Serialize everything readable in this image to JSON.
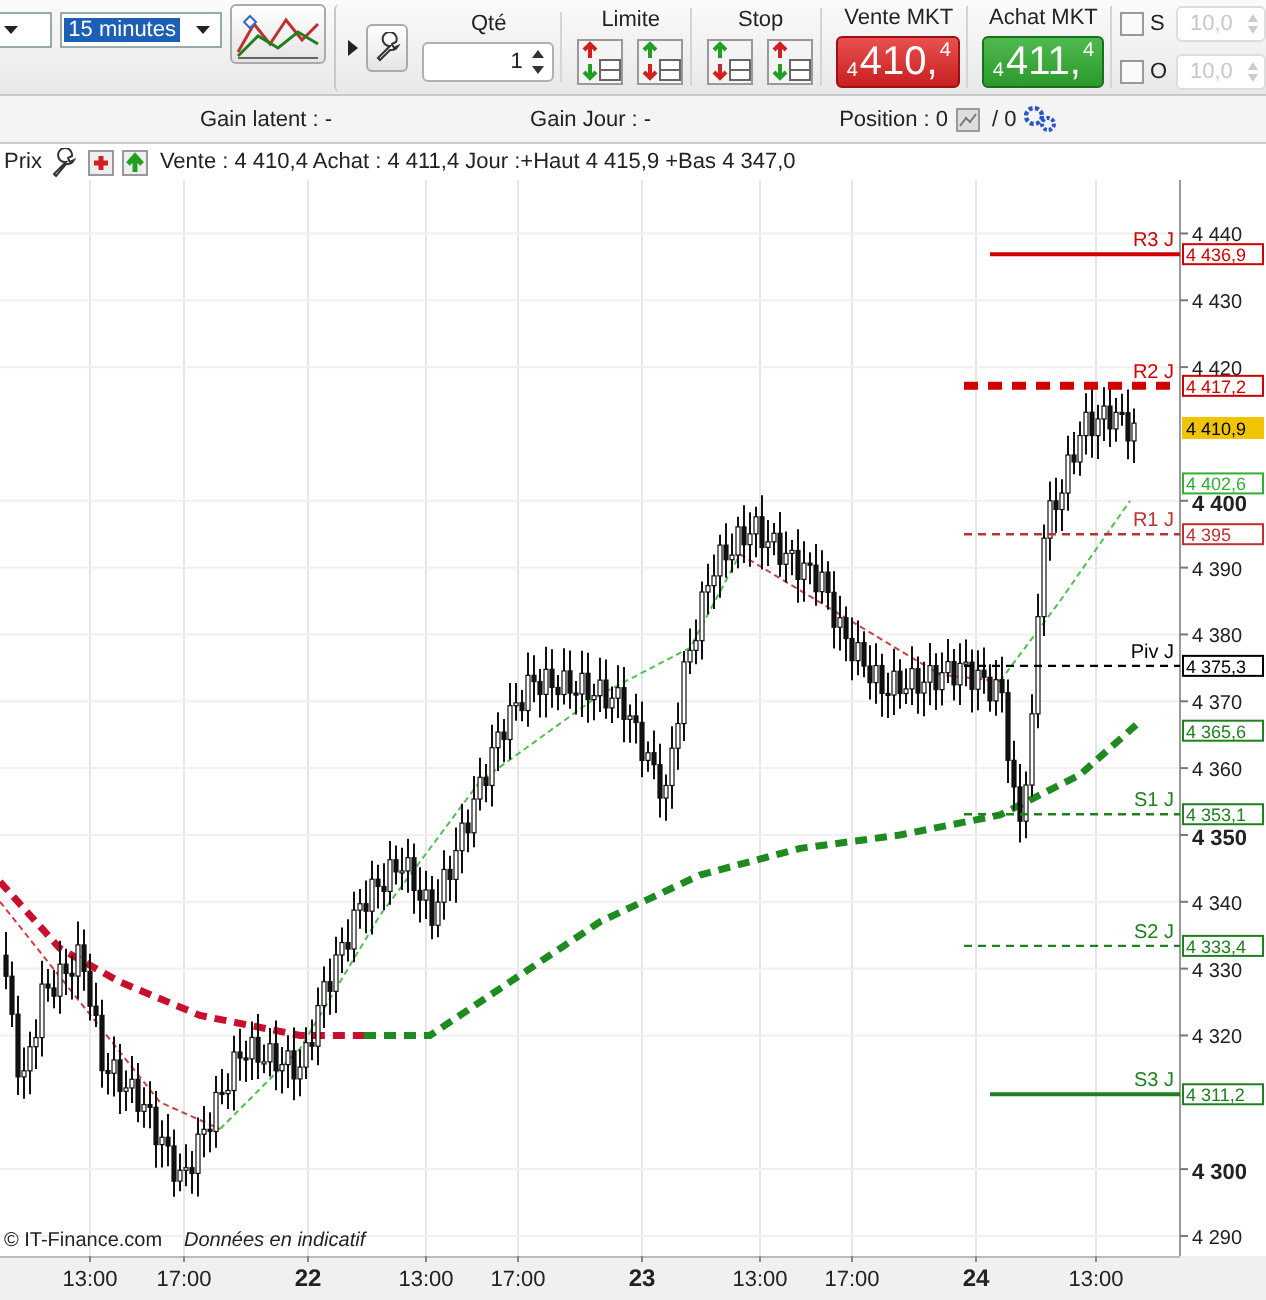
{
  "toolbar": {
    "interval": {
      "value": "15 minutes",
      "selected": true
    },
    "quantity": {
      "label": "Qté",
      "value": "1"
    },
    "limit": {
      "label": "Limite"
    },
    "stop": {
      "label": "Stop"
    },
    "orders": [
      {
        "kind": "sell",
        "label": "Vente MKT",
        "prefix": "4",
        "big": "410,",
        "suffix": "4"
      },
      {
        "kind": "buy",
        "label": "Achat MKT",
        "prefix": "4",
        "big": "411,",
        "suffix": "4"
      }
    ],
    "options": [
      {
        "label": "S",
        "checked": false,
        "value": "10,0",
        "disabled": true
      },
      {
        "label": "O",
        "checked": false,
        "value": "10,0",
        "disabled": true
      }
    ]
  },
  "info_bar": {
    "gain_latent": "Gain latent : -",
    "gain_jour": "Gain Jour : -",
    "position": "Position : 0",
    "position_total": "/ 0"
  },
  "chart": {
    "title": "Prix",
    "quote": "Vente : 4 410,4 Achat : 4 411,4 Jour :+Haut 4 415,9 +Bas 4 347,0",
    "credit": "© IT-Finance.com",
    "note": "Données en indicatif",
    "price_labels": [
      {
        "label": "4 440",
        "bold": false
      },
      {
        "label": "4 430",
        "bold": false
      },
      {
        "label": "4 420",
        "bold": false
      },
      {
        "label": "4 400",
        "bold": true
      },
      {
        "label": "4 390",
        "bold": false
      },
      {
        "label": "4 380",
        "bold": false
      },
      {
        "label": "4 370",
        "bold": false
      },
      {
        "label": "4 360",
        "bold": false
      },
      {
        "label": "4 350",
        "bold": true
      },
      {
        "label": "4 340",
        "bold": false
      },
      {
        "label": "4 330",
        "bold": false
      },
      {
        "label": "4 320",
        "bold": false
      },
      {
        "label": "4 300",
        "bold": true
      },
      {
        "label": "4 290",
        "bold": false
      }
    ],
    "time_labels": [
      {
        "label": "13:00",
        "bold": false
      },
      {
        "label": "17:00",
        "bold": false
      },
      {
        "label": "22",
        "bold": true
      },
      {
        "label": "13:00",
        "bold": false
      },
      {
        "label": "17:00",
        "bold": false
      },
      {
        "label": "23",
        "bold": true
      },
      {
        "label": "13:00",
        "bold": false
      },
      {
        "label": "17:00",
        "bold": false
      },
      {
        "label": "24",
        "bold": true
      },
      {
        "label": "13:00",
        "bold": false
      }
    ],
    "levels": [
      {
        "label": "R3 J",
        "price": "4 436,9",
        "color": "#d00000"
      },
      {
        "label": "R2 J",
        "price": "4 417,2",
        "color": "#d00000"
      },
      {
        "label": "R1 J",
        "price": "4 395",
        "color": "#c03030"
      },
      {
        "label": "Piv J",
        "price": "4 375,3",
        "color": "#000000"
      },
      {
        "label": "S1 J",
        "price": "4 353,1",
        "color": "#208020"
      },
      {
        "label": "S2 J",
        "price": "4 333,4",
        "color": "#208020"
      },
      {
        "label": "S3 J",
        "price": "4 311,2",
        "color": "#208020"
      }
    ],
    "price_tags": [
      {
        "kind": "current",
        "text": "4 410,9"
      },
      {
        "kind": "indicator",
        "text": "4 402,6"
      },
      {
        "kind": "indicator",
        "text": "4 365,6"
      }
    ]
  }
}
